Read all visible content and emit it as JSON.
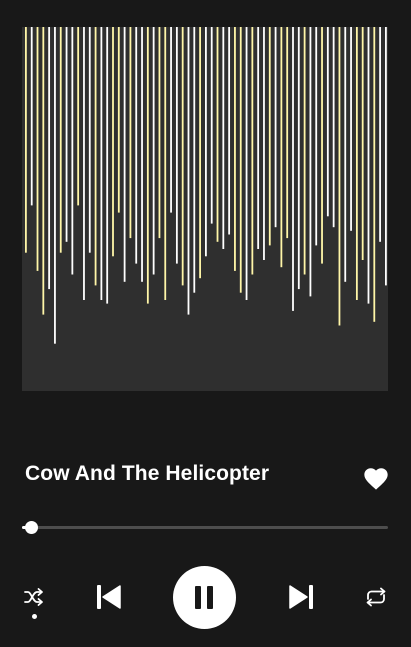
{
  "player": {
    "track_title": "Cow And The Helicopter",
    "liked": true,
    "progress_fraction": 0.02,
    "shuffle_active": true,
    "is_playing": true
  },
  "artwork": {
    "background_color": "#2f2f2f",
    "bar_colors": [
      "#ffffff",
      "#fff6a8"
    ],
    "bar_levels": [
      0.62,
      0.49,
      0.67,
      0.79,
      0.72,
      0.87,
      0.62,
      0.59,
      0.68,
      0.49,
      0.75,
      0.62,
      0.71,
      0.75,
      0.76,
      0.63,
      0.51,
      0.7,
      0.58,
      0.65,
      0.7,
      0.76,
      0.68,
      0.58,
      0.75,
      0.51,
      0.65,
      0.71,
      0.79,
      0.73,
      0.69,
      0.63,
      0.54,
      0.59,
      0.61,
      0.57,
      0.67,
      0.73,
      0.75,
      0.68,
      0.61,
      0.64,
      0.6,
      0.55,
      0.66,
      0.58,
      0.78,
      0.72,
      0.68,
      0.74,
      0.6,
      0.65,
      0.52,
      0.55,
      0.82,
      0.7,
      0.56,
      0.75,
      0.64,
      0.76,
      0.81,
      0.59,
      0.71
    ]
  },
  "colors": {
    "background": "#181818",
    "accent": "#ffffff",
    "track_inactive": "#4d4d4d"
  },
  "icons": {
    "like": "heart-icon",
    "shuffle": "shuffle-icon",
    "previous": "skip-previous-icon",
    "play_pause": "pause-icon",
    "next": "skip-next-icon",
    "repeat": "repeat-icon"
  }
}
